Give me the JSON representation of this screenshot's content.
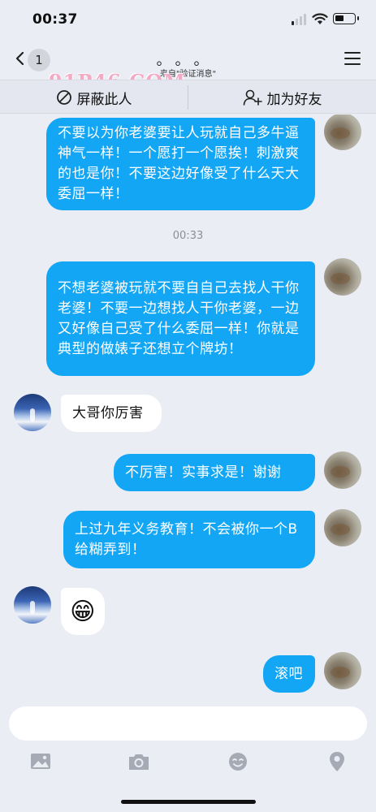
{
  "status": {
    "time": "00:37"
  },
  "nav": {
    "back_badge": "1",
    "title": "。。。",
    "subtitle": "来自\"验证消息\"",
    "watermark": "91P46.COM"
  },
  "actions": {
    "block_label": "屏蔽此人",
    "add_friend_label": "加为好友"
  },
  "messages": [
    {
      "sender": "me",
      "text": "不要以为你老婆要让人玩就自己多牛逼神气一样！一个愿打一个愿挨！刺激爽的也是你！不要这边好像受了什么天大委屈一样！"
    },
    {
      "type": "time",
      "text": "00:33"
    },
    {
      "sender": "me",
      "text": "不想老婆被玩就不要自自己去找人干你老婆！不要一边想找人干你老婆，一边又好像自己受了什么委屈一样！你就是典型的做婊子还想立个牌坊！"
    },
    {
      "sender": "other",
      "text": "大哥你厉害"
    },
    {
      "sender": "me",
      "text": "不厉害！实事求是！谢谢"
    },
    {
      "sender": "me",
      "text": "上过九年义务教育！不会被你一个B给糊弄到！"
    },
    {
      "sender": "other",
      "text": "😁"
    },
    {
      "sender": "me",
      "text": "滚吧"
    }
  ],
  "toolbar": {
    "icons": [
      "image-icon",
      "camera-icon",
      "emoji-icon",
      "location-icon"
    ]
  },
  "colors": {
    "bubble_out": "#13a6f4",
    "bubble_in": "#ffffff",
    "background": "#ebedf5"
  }
}
